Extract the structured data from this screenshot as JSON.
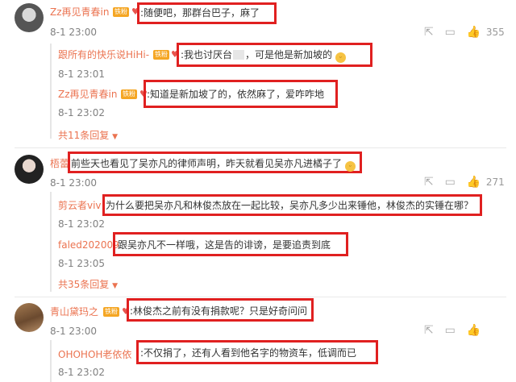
{
  "comments": [
    {
      "user": "Zz再见青春in",
      "badge": "铁粉",
      "text": ":随便吧，那群台巴子，麻了",
      "time": "8-1 23:00",
      "likes": "355",
      "replies": [
        {
          "user": "跟所有的快乐说HiHi-",
          "badge": "铁粉",
          "text": ":我也讨厌台",
          "text2": "，可是他是新加坡的",
          "time": "8-1 23:01"
        },
        {
          "user": "Zz再见青春in",
          "badge": "铁粉",
          "text": ":知道是新加坡了的，依然麻了，爱咋咋地",
          "time": "8-1 23:02"
        }
      ],
      "more": "共11条回复"
    },
    {
      "user": "梧蕾",
      "text": "前些天也看见了吴亦凡的律师声明，昨天就看见吴亦凡进橘子了",
      "time": "8-1 23:00",
      "likes": "271",
      "replies": [
        {
          "user": "剪云者viv",
          "text": "为什么要把吴亦凡和林俊杰放在一起比较，吴亦凡多少出来锤他，林俊杰的实锤在哪？",
          "time": "8-1 23:02"
        },
        {
          "user": "faled202009",
          "text": "跟吴亦凡不一样哦，这是告的诽谤，是要追责到底",
          "time": "8-1 23:05"
        }
      ],
      "more": "共35条回复"
    },
    {
      "user": "青山黛玛之",
      "badge": "铁粉",
      "text": ":林俊杰之前有没有捐款呢？只是好奇问问",
      "time": "8-1 23:00",
      "replies": [
        {
          "user": "OHOHOH老依依",
          "text": ":不仅捐了，还有人看到他名字的物资车，低调而已",
          "time": "8-1 23:02"
        }
      ]
    }
  ],
  "icons": [
    "share-icon",
    "comment-icon",
    "like-icon",
    "smile-emoji-icon"
  ],
  "colors": {
    "username": "#eb7350",
    "highlight_box": "#e02020",
    "time": "#808080"
  }
}
